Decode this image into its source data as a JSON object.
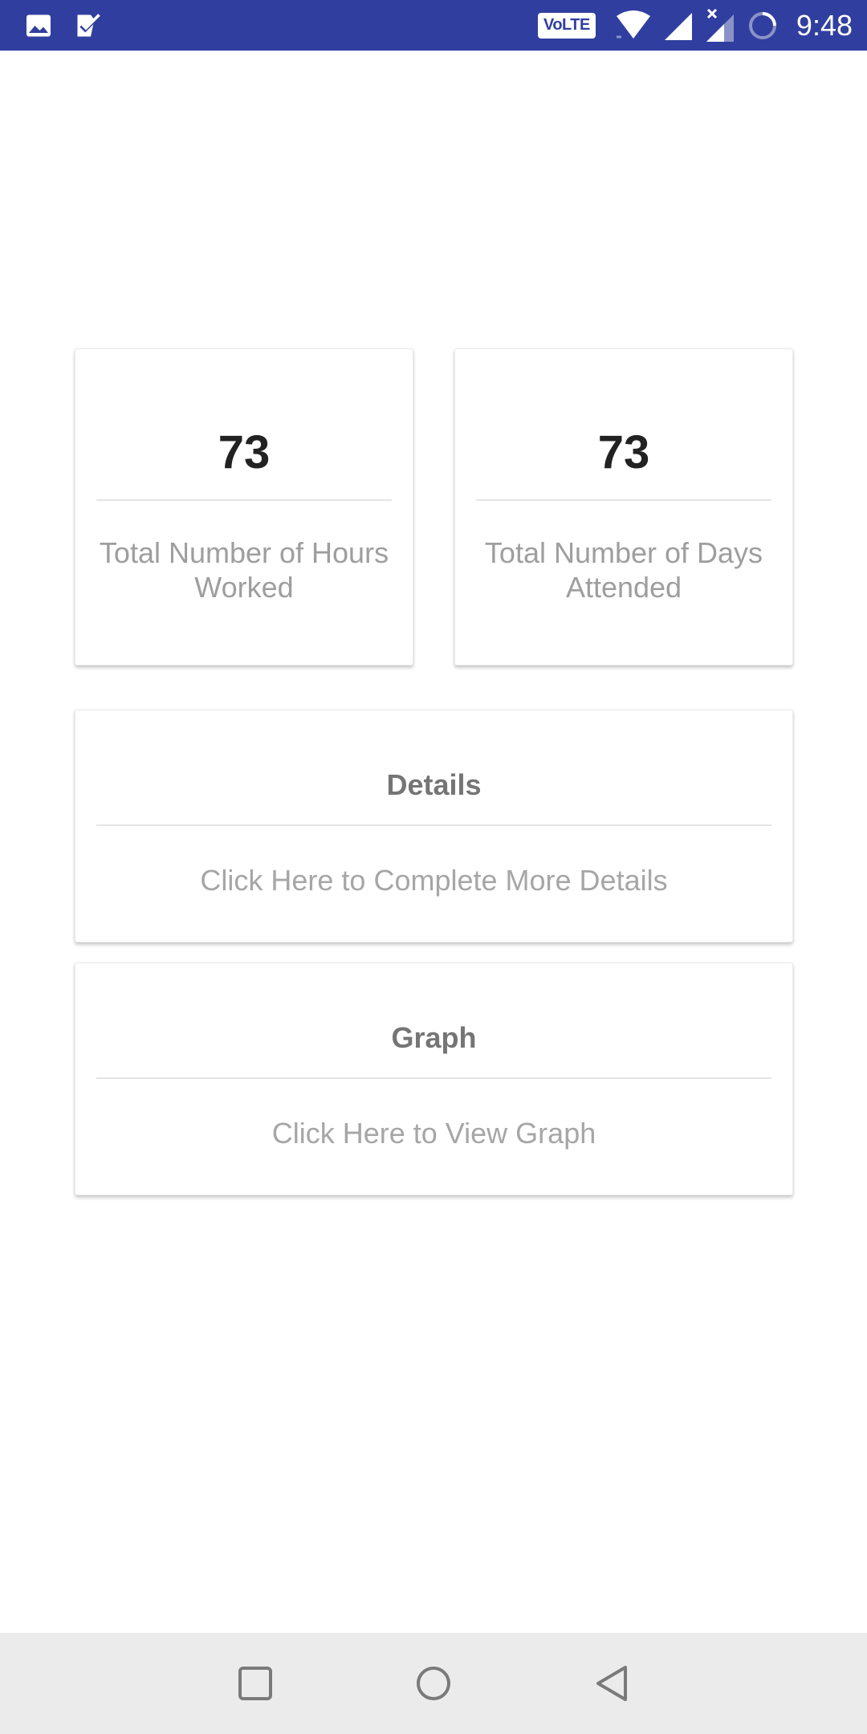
{
  "status_bar": {
    "left_icons": [
      "image-icon",
      "task-check-icon"
    ],
    "volte_label": "VoLTE",
    "right_icons": [
      "wifi-icon",
      "signal-icon",
      "signal-no-data-icon",
      "sync-icon"
    ],
    "time": "9:48",
    "background": "#303f9f"
  },
  "stats": [
    {
      "value": "73",
      "label": "Total Number of Hours Worked"
    },
    {
      "value": "73",
      "label": "Total Number of Days Attended"
    }
  ],
  "details_card": {
    "title": "Details",
    "subtitle": "Click Here to Complete More Details"
  },
  "graph_card": {
    "title": "Graph",
    "subtitle": "Click Here to View Graph"
  },
  "nav_bar": {
    "buttons": [
      "recents-square-icon",
      "home-circle-icon",
      "back-triangle-icon"
    ],
    "background": "#ebebeb"
  }
}
